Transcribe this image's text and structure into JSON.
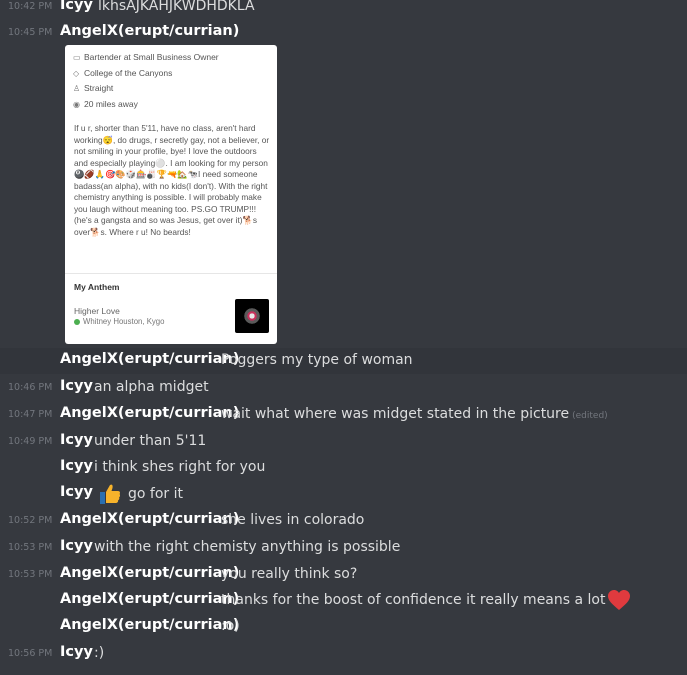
{
  "messages": [
    {
      "time": "10:42 PM",
      "author": "Icyy",
      "text": "lkhsAJKAHJKWDHDKLA"
    },
    {
      "time": "10:45 PM",
      "author": "AngelX(erupt/currian)",
      "text": ""
    },
    {
      "time": "",
      "author": "AngelX(erupt/currian)",
      "text": "Poggers my type of woman"
    },
    {
      "time": "10:46 PM",
      "author": "Icyy",
      "text": "an alpha midget"
    },
    {
      "time": "10:47 PM",
      "author": "AngelX(erupt/currian)",
      "text": "wait what where was midget stated  in the picture",
      "edited": "(edited)"
    },
    {
      "time": "10:49 PM",
      "author": "Icyy",
      "text": "under than 5'11"
    },
    {
      "time": "",
      "author": "Icyy",
      "text": "i think shes right for you"
    },
    {
      "time": "",
      "author": "Icyy",
      "text": "go for it",
      "emoji": "thumbs-up-icon"
    },
    {
      "time": "10:52 PM",
      "author": "AngelX(erupt/currian)",
      "text": "she lives in colorado"
    },
    {
      "time": "10:53 PM",
      "author": "Icyy",
      "text": "with the right chemisty anything is possible"
    },
    {
      "time": "10:53 PM",
      "author": "AngelX(erupt/currian)",
      "text": "you really think so?"
    },
    {
      "time": "",
      "author": "AngelX(erupt/currian)",
      "text": "thanks for the boost of confidence it really means a lot",
      "emoji": "heart-icon"
    },
    {
      "time": "",
      "author": "AngelX(erupt/currian)",
      "text": ":o)"
    },
    {
      "time": "10:56 PM",
      "author": "Icyy",
      "text": ":)"
    }
  ],
  "profile_card": {
    "job": "Bartender at Small Business Owner",
    "school": "College of the Canyons",
    "orientation": "Straight",
    "distance": "20 miles away",
    "bio_1": "If u r, shorter than 5'11, have no class, aren't hard working",
    "bio_2": ", do drugs, r secretly gay, not a believer, or not smiling in your profile, bye! I love the outdoors and especially playing",
    "bio_3": ". I am looking for my person",
    "bio_4": "I need someone badass(an alpha), with no kids(I don't). With the right chemistry anything is possible. I will probably make you laugh without meaning too.  PS.GO TRUMP!!! (he's a gangsta and so was Jesus, get over it)",
    "bio_5": "s over",
    "bio_6": "s. Where r u! No beards!",
    "anthem_heading": "My Anthem",
    "song": "Higher Love",
    "artist": "Whitney Houston, Kygo"
  },
  "colors": {
    "background": "#36393f",
    "timestamp": "#72767d",
    "text": "#dcddde",
    "author": "#ffffff",
    "card": "#ffffff",
    "heart": "#e03a3e",
    "thumb": "#f7b32b"
  }
}
